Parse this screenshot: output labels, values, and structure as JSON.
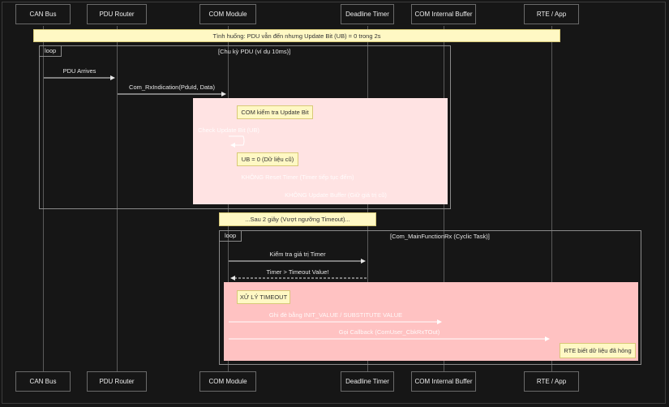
{
  "participants": [
    "CAN Bus",
    "PDU Router",
    "COM Module",
    "Deadline Timer",
    "COM Internal Buffer",
    "RTE / App"
  ],
  "scenario_note": "Tình huống: PDU vẫn đến nhưng Update Bit (UB) = 0 trong 2s",
  "loop1": {
    "tag": "loop",
    "condition": "[Chu kỳ PDU (ví dụ 10ms)]"
  },
  "messages1": {
    "pdu_arrives": "PDU Arrives",
    "rx_indication": "Com_RxIndication(PduId, Data)"
  },
  "check_block": {
    "note_check": "COM kiểm tra Update Bit",
    "self_msg": "Check Update Bit (UB)",
    "note_ub": "UB = 0 (Dữ liệu cũ)",
    "no_reset": "KHÔNG Reset Timer (Timer tiếp tục đếm)",
    "no_update": "KHÔNG Update Buffer (Giữ giá trị cũ)"
  },
  "note_after": "...Sau 2 giây (Vượt ngưỡng Timeout)...",
  "loop2": {
    "tag": "loop",
    "condition": "[Com_MainFunctionRx (Cyclic Task)]"
  },
  "messages2": {
    "check_timer": "Kiểm tra giá trị Timer",
    "timer_over": "Timer > Timeout Value!"
  },
  "timeout_block": {
    "note_title": "XỬ LÝ TIMEOUT",
    "overwrite": "Ghi đè bằng INIT_VALUE / SUBSTITUTE VALUE",
    "callback": "Gọi Callback (ComUser_CbkRxTOut)",
    "note_rte": "RTE biết dữ liệu đã hỏng"
  },
  "colors": {
    "background": "#161616",
    "note_fill": "#fff8c4",
    "rect_light": "#ffe3e3",
    "rect_strong": "#ffc2c2"
  }
}
